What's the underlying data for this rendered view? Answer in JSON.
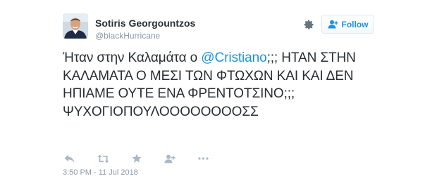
{
  "user": {
    "name": "Sotiris Georgountzos",
    "handle": "@blackHurricane"
  },
  "follow": {
    "label": "Follow"
  },
  "tweet": {
    "text_before": "Ήταν στην Καλαμάτα ο ",
    "mention": "@Cristiano",
    "text_after": ";;; ΗΤΑΝ ΣΤΗΝ ΚΑΛΑΜΑΤΑ Ο ΜΕΣΙ ΤΩΝ ΦΤΩΧΩΝ ΚΑΙ ΚΑΙ ΔΕΝ ΗΠΙΑΜΕ ΟΥΤΕ ΕΝΑ ΦΡΕΝΤΟΤΣΙΝΟ;;; ΨΥΧΟΓΙΟΠΟΥΛΟΟΟΟΟΟΟΟΣΣ",
    "timestamp": "3:50 PM - 11 Jul 2018"
  },
  "actions": [
    "reply-icon",
    "retweet-icon",
    "like-icon",
    "follow-icon",
    "more-icon"
  ],
  "colors": {
    "link": "#1b95e0",
    "text": "#292f33",
    "muted": "#8899a6",
    "action_icon": "#aab8c2"
  }
}
